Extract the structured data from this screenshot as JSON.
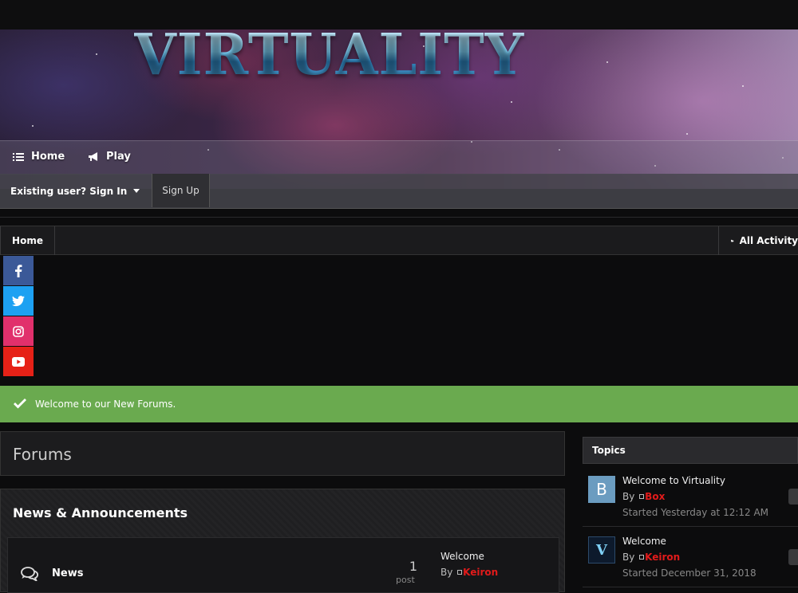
{
  "site": {
    "logo_text": "VIRTUALITY"
  },
  "nav": {
    "items": [
      {
        "label": "Home",
        "icon": "list-icon"
      },
      {
        "label": "Play",
        "icon": "megaphone-icon"
      }
    ]
  },
  "user": {
    "signin_label": "Existing user? Sign In",
    "signup_label": "Sign Up"
  },
  "breadcrumb": {
    "home": "Home",
    "all_activity": "All Activity"
  },
  "social": [
    "facebook",
    "twitter",
    "instagram",
    "youtube"
  ],
  "announcement": {
    "text": "Welcome to our New Forums."
  },
  "forums": {
    "title": "Forums",
    "categories": [
      {
        "title": "News & Announcements",
        "forums": [
          {
            "name": "News",
            "post_count": "1",
            "post_label": "post",
            "last_post_title": "Welcome",
            "last_post_by_prefix": "By",
            "last_post_author": "Keiron"
          }
        ]
      }
    ]
  },
  "topics": {
    "title": "Topics",
    "items": [
      {
        "avatar_letter": "B",
        "title": "Welcome to Virtuality",
        "by_prefix": "By",
        "author": "Box",
        "started": "Started Yesterday at 12:12 AM"
      },
      {
        "avatar_letter": "V",
        "title": "Welcome",
        "by_prefix": "By",
        "author": "Keiron",
        "started": "Started December 31, 2018"
      }
    ]
  },
  "colors": {
    "accent_green": "#6aaa4f",
    "author_red": "#e21b1b",
    "facebook": "#3b5998",
    "twitter": "#1da1f2",
    "instagram": "#e1306c",
    "youtube": "#e62117"
  }
}
